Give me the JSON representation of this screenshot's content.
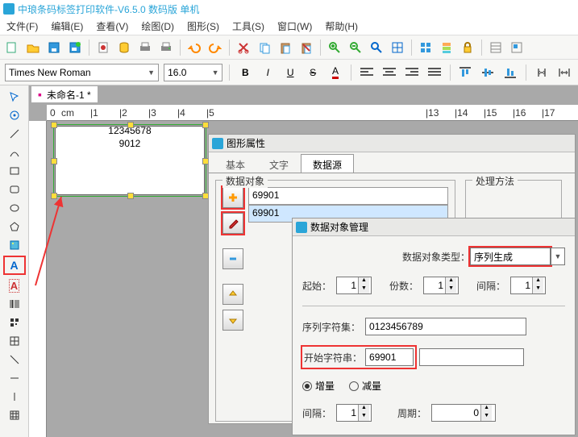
{
  "app": {
    "title": "中琅条码标签打印软件-V6.5.0 数码版 单机"
  },
  "menu": [
    "文件(F)",
    "编辑(E)",
    "查看(V)",
    "绘图(D)",
    "图形(S)",
    "工具(S)",
    "窗口(W)",
    "帮助(H)"
  ],
  "format": {
    "font": "Times New Roman",
    "size": "16.0"
  },
  "doc": {
    "tabname": "未命名-1 *"
  },
  "canvas": {
    "line1": "12345678",
    "line2": "9012"
  },
  "ruler_unit": "cm",
  "props": {
    "title": "图形属性",
    "tabs": [
      "基本",
      "文字",
      "数据源"
    ],
    "ds_legend": "数据对象",
    "proc_legend": "处理方法",
    "rows": [
      "69901",
      "69901"
    ]
  },
  "mgr": {
    "title": "数据对象管理",
    "type_label": "数据对象类型：",
    "type_value": "序列生成",
    "start_label": "起始：",
    "start_val": "1",
    "copies_label": "份数：",
    "copies_val": "1",
    "gap_label": "间隔：",
    "gap_val": "1",
    "charset_label": "序列字符集：",
    "charset_val": "0123456789",
    "startstr_label": "开始字符串：",
    "startstr_val": "69901",
    "inc_label": "增量",
    "dec_label": "减量",
    "interval_label": "间隔：",
    "interval_val": "1",
    "period_label": "周期：",
    "period_val": "0"
  }
}
